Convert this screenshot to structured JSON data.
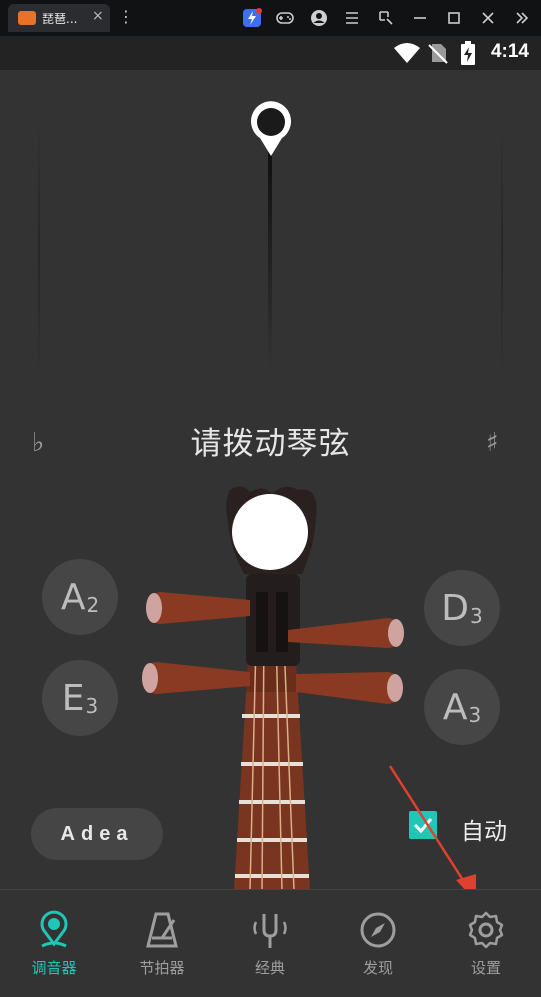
{
  "window": {
    "tab_title": "琵琶...",
    "tab_close": "×",
    "more": "⋮"
  },
  "status": {
    "time": "4:14"
  },
  "tuner": {
    "prompt": "请拨动琴弦",
    "flat_symbol": "♭",
    "sharp_symbol": "♯",
    "strings": [
      {
        "note": "A",
        "octave": "2"
      },
      {
        "note": "E",
        "octave": "3"
      },
      {
        "note": "D",
        "octave": "3"
      },
      {
        "note": "A",
        "octave": "3"
      }
    ],
    "preset": "Adea",
    "auto_label": "自动",
    "auto_checked": true,
    "accent_color": "#20c6b6"
  },
  "nav": {
    "items": [
      {
        "label": "调音器",
        "icon": "tuner-pin-icon",
        "active": true
      },
      {
        "label": "节拍器",
        "icon": "metronome-icon",
        "active": false
      },
      {
        "label": "经典",
        "icon": "tuning-fork-icon",
        "active": false
      },
      {
        "label": "发现",
        "icon": "compass-icon",
        "active": false
      },
      {
        "label": "设置",
        "icon": "gear-icon",
        "active": false
      }
    ]
  }
}
